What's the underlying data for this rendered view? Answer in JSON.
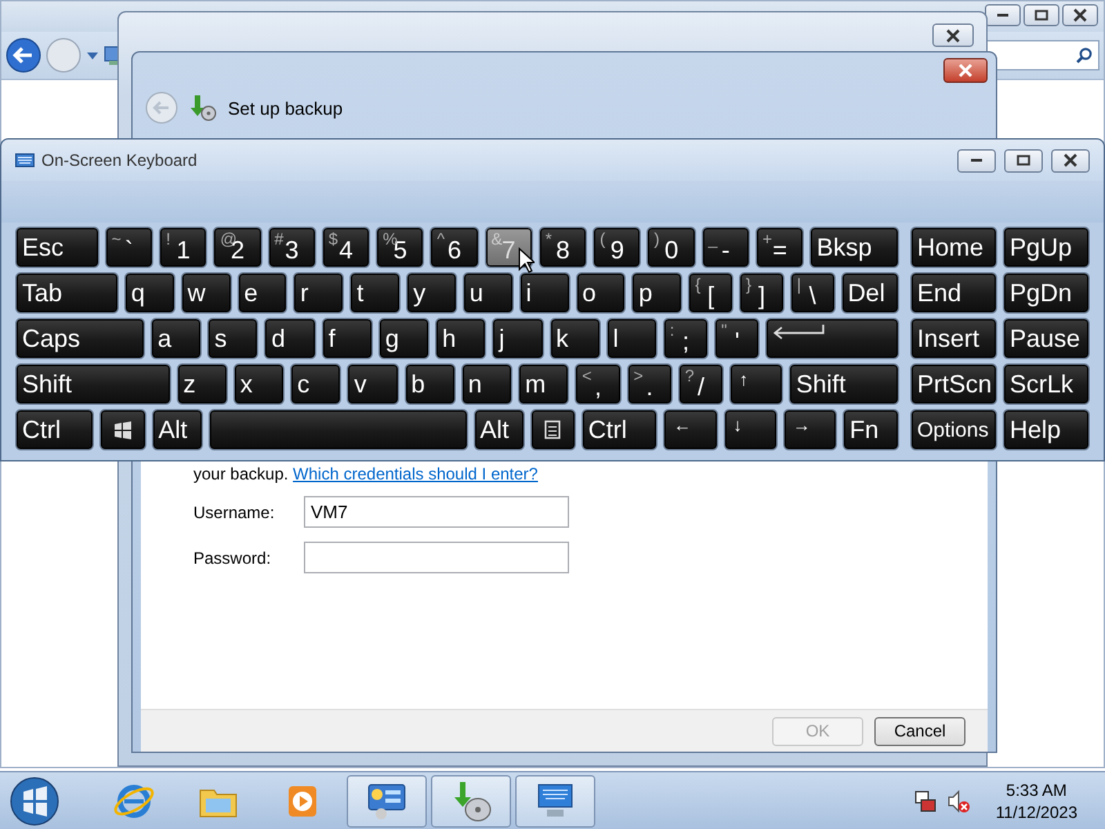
{
  "dialog": {
    "title": "Set up backup",
    "text": "your backup.",
    "link": "Which credentials should I enter?",
    "fields": [
      {
        "label": "Username:",
        "value": "VM7"
      },
      {
        "label": "Password:"
      }
    ],
    "buttons": [
      {
        "label": "OK",
        "disabled": true
      },
      {
        "label": "Cancel",
        "disabled": false
      }
    ]
  },
  "keyboard": {
    "title": "On-Screen Keyboard",
    "rows": [
      {
        "main": [
          {
            "label": "Esc",
            "kind": "esc",
            "hovered": false
          },
          {
            "label": "`",
            "shift": "~",
            "kind": "key",
            "hovered": false
          },
          {
            "label": "1",
            "shift": "!",
            "kind": "key",
            "hovered": false
          },
          {
            "label": "2",
            "shift": "@",
            "kind": "key",
            "hovered": false
          },
          {
            "label": "3",
            "shift": "#",
            "kind": "key",
            "hovered": false
          },
          {
            "label": "4",
            "shift": "$",
            "kind": "key",
            "hovered": false
          },
          {
            "label": "5",
            "shift": "%",
            "kind": "key",
            "hovered": false
          },
          {
            "label": "6",
            "shift": "^",
            "kind": "key",
            "hovered": false
          },
          {
            "label": "7",
            "shift": "&",
            "kind": "key",
            "hovered": true
          },
          {
            "label": "8",
            "shift": "*",
            "kind": "key",
            "hovered": false
          },
          {
            "label": "9",
            "shift": "(",
            "kind": "key",
            "hovered": false
          },
          {
            "label": "0",
            "shift": ")",
            "kind": "key",
            "hovered": false
          },
          {
            "label": "-",
            "shift": "_",
            "kind": "key",
            "hovered": false
          },
          {
            "label": "=",
            "shift": "+",
            "kind": "key",
            "hovered": false
          },
          {
            "label": "Bksp",
            "kind": "bksp",
            "hovered": false
          }
        ],
        "nav": [
          {
            "label": "Home",
            "hovered": false
          },
          {
            "label": "PgUp",
            "hovered": false
          }
        ]
      },
      {
        "main": [
          {
            "label": "Tab",
            "kind": "tab",
            "hovered": false
          },
          {
            "label": "q",
            "kind": "key",
            "hovered": false
          },
          {
            "label": "w",
            "kind": "key",
            "hovered": false
          },
          {
            "label": "e",
            "kind": "key",
            "hovered": false
          },
          {
            "label": "r",
            "kind": "key",
            "hovered": false
          },
          {
            "label": "t",
            "kind": "key",
            "hovered": false
          },
          {
            "label": "y",
            "kind": "key",
            "hovered": false
          },
          {
            "label": "u",
            "kind": "key",
            "hovered": false
          },
          {
            "label": "i",
            "kind": "key",
            "hovered": false
          },
          {
            "label": "o",
            "kind": "key",
            "hovered": false
          },
          {
            "label": "p",
            "kind": "key",
            "hovered": false
          },
          {
            "label": "[",
            "shift": "{",
            "kind": "key",
            "hovered": false
          },
          {
            "label": "]",
            "shift": "}",
            "kind": "key",
            "hovered": false
          },
          {
            "label": "\\",
            "shift": "|",
            "kind": "key",
            "hovered": false
          },
          {
            "label": "Del",
            "kind": "del",
            "hovered": false
          }
        ],
        "nav": [
          {
            "label": "End",
            "hovered": false
          },
          {
            "label": "PgDn",
            "hovered": false
          }
        ]
      },
      {
        "main": [
          {
            "label": "Caps",
            "kind": "caps",
            "hovered": false
          },
          {
            "label": "a",
            "kind": "key",
            "hovered": false
          },
          {
            "label": "s",
            "kind": "key",
            "hovered": false
          },
          {
            "label": "d",
            "kind": "key",
            "hovered": false
          },
          {
            "label": "f",
            "kind": "key",
            "hovered": false
          },
          {
            "label": "g",
            "kind": "key",
            "hovered": false
          },
          {
            "label": "h",
            "kind": "key",
            "hovered": false
          },
          {
            "label": "j",
            "kind": "key",
            "hovered": false
          },
          {
            "label": "k",
            "kind": "key",
            "hovered": false
          },
          {
            "label": "l",
            "kind": "key",
            "hovered": false
          },
          {
            "label": ";",
            "shift": ":",
            "kind": "key",
            "hovered": false
          },
          {
            "label": "'",
            "shift": "\"",
            "kind": "key",
            "hovered": false
          },
          {
            "kind": "enter",
            "hovered": false
          }
        ],
        "nav": [
          {
            "label": "Insert",
            "hovered": false
          },
          {
            "label": "Pause",
            "hovered": false
          }
        ]
      },
      {
        "main": [
          {
            "label": "Shift",
            "kind": "shift",
            "hovered": false
          },
          {
            "label": "z",
            "kind": "key",
            "hovered": false
          },
          {
            "label": "x",
            "kind": "key",
            "hovered": false
          },
          {
            "label": "c",
            "kind": "key",
            "hovered": false
          },
          {
            "label": "v",
            "kind": "key",
            "hovered": false
          },
          {
            "label": "b",
            "kind": "key",
            "hovered": false
          },
          {
            "label": "n",
            "kind": "key",
            "hovered": false
          },
          {
            "label": "m",
            "kind": "key",
            "hovered": false
          },
          {
            "label": ",",
            "shift": "<",
            "kind": "key",
            "hovered": false
          },
          {
            "label": ".",
            "shift": ">",
            "kind": "key",
            "hovered": false
          },
          {
            "label": "/",
            "shift": "?",
            "kind": "key",
            "hovered": false
          },
          {
            "label": "↑",
            "kind": "arrow",
            "hovered": false
          },
          {
            "label": "Shift",
            "kind": "rshift",
            "hovered": false
          }
        ],
        "nav": [
          {
            "label": "PrtScn",
            "hovered": false
          },
          {
            "label": "ScrLk",
            "hovered": false
          }
        ]
      },
      {
        "main": [
          {
            "label": "Ctrl",
            "kind": "ctrl",
            "hovered": false
          },
          {
            "kind": "win",
            "hovered": false
          },
          {
            "label": "Alt",
            "kind": "key",
            "hovered": false
          },
          {
            "kind": "space",
            "hovered": false
          },
          {
            "label": "Alt",
            "kind": "key",
            "hovered": false
          },
          {
            "kind": "menu",
            "hovered": false
          },
          {
            "label": "Ctrl",
            "kind": "ctrl2",
            "hovered": false
          },
          {
            "label": "←",
            "kind": "arrow",
            "hovered": false
          },
          {
            "label": "↓",
            "kind": "arrow",
            "hovered": false
          },
          {
            "label": "→",
            "kind": "arrow",
            "hovered": false
          },
          {
            "label": "Fn",
            "kind": "fn",
            "hovered": false
          }
        ],
        "nav": [
          {
            "label": "Options",
            "hovered": false,
            "small": true
          },
          {
            "label": "Help",
            "hovered": false
          }
        ]
      }
    ]
  },
  "taskbar": {
    "apps": [
      {
        "kind": "browser",
        "active": false
      },
      {
        "kind": "folder",
        "active": false
      },
      {
        "kind": "media",
        "active": false
      },
      {
        "kind": "control-panel",
        "active": true
      },
      {
        "kind": "backup",
        "active": true
      },
      {
        "kind": "keyboard",
        "active": true
      }
    ],
    "tray": [
      {
        "kind": "network"
      },
      {
        "kind": "volume-muted"
      }
    ],
    "time": "5:33 AM",
    "date": "11/12/2023"
  }
}
